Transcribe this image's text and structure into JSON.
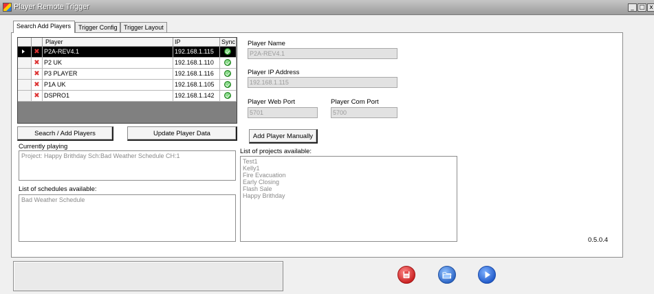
{
  "window": {
    "title": "Player Remote Trigger",
    "controls": [
      "_",
      "□",
      "x"
    ]
  },
  "tabs": [
    {
      "label": "Search Add Players",
      "active": true
    },
    {
      "label": "Trigger Config",
      "active": false
    },
    {
      "label": "Trigger Layout",
      "active": false
    }
  ],
  "grid": {
    "columns": [
      "Player",
      "IP",
      "Sync"
    ],
    "rows": [
      {
        "name": "P2A-REV4.1",
        "ip": "192.168.1.115",
        "synced": true,
        "selected": true
      },
      {
        "name": "P2 UK",
        "ip": "192.168.1.110",
        "synced": true,
        "selected": false
      },
      {
        "name": "P3 PLAYER",
        "ip": "192.168.1.116",
        "synced": true,
        "selected": false
      },
      {
        "name": "P1A UK",
        "ip": "192.168.1.105",
        "synced": true,
        "selected": false
      },
      {
        "name": "DSPRO1",
        "ip": "192.168.1.142",
        "synced": true,
        "selected": false
      }
    ]
  },
  "buttons": {
    "search_add": "Seacrh / Add Players",
    "update": "Update Player Data",
    "add_manual": "Add Player Manually"
  },
  "currently_playing": {
    "label": "Currently playing",
    "value": "Project: Happy Brithday Sch:Bad Weather Schedule CH:1"
  },
  "schedules": {
    "label": "List of schedules available:",
    "items": [
      "Bad Weather Schedule"
    ]
  },
  "player_details": {
    "name_label": "Player Name",
    "name_value": "P2A-REV4.1",
    "ip_label": "Player IP Address",
    "ip_value": "192.168.1.115",
    "web_port_label": "Player Web Port",
    "web_port_value": "5701",
    "com_port_label": "Player Com Port",
    "com_port_value": "5700"
  },
  "projects": {
    "label": "List of projects available:",
    "items": [
      "Test1",
      "Kelly1",
      "Fire Evacuation",
      "Early Closing",
      "Flash Sale",
      "Happy Brithday"
    ]
  },
  "version": "0.5.0.4",
  "colors": {
    "stop": "#e03030",
    "open": "#3a7fdc",
    "play": "#2e6fd6"
  },
  "icons": {
    "stop": "floppy-stop-icon",
    "open": "folder-icon",
    "play": "play-icon"
  }
}
